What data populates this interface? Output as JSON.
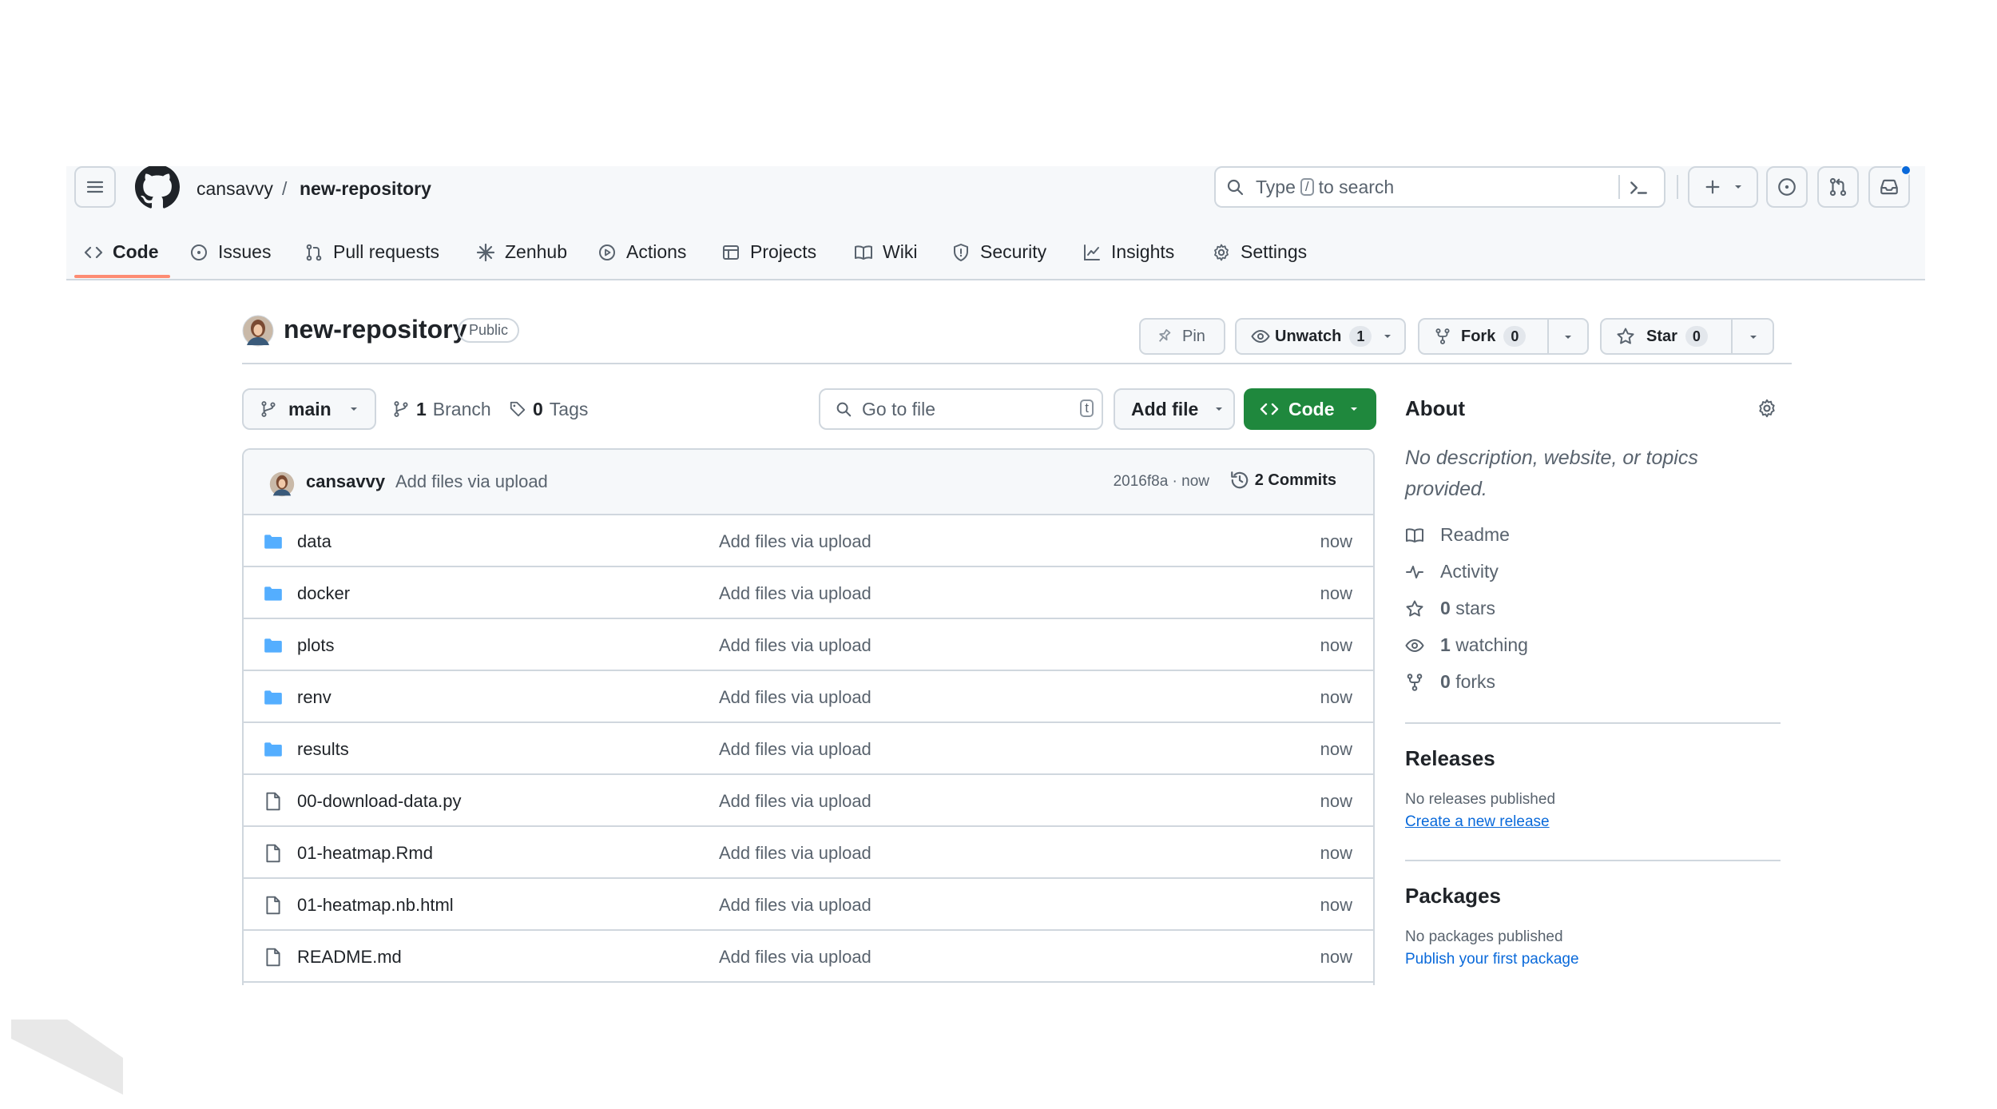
{
  "header": {
    "owner": "cansavvy",
    "separator": "/",
    "repo": "new-repository",
    "search_prefix": "Type",
    "search_key": "/",
    "search_suffix": "to search"
  },
  "tabs": [
    {
      "label": "Code",
      "selected": true
    },
    {
      "label": "Issues"
    },
    {
      "label": "Pull requests"
    },
    {
      "label": "Zenhub"
    },
    {
      "label": "Actions"
    },
    {
      "label": "Projects"
    },
    {
      "label": "Wiki"
    },
    {
      "label": "Security"
    },
    {
      "label": "Insights"
    },
    {
      "label": "Settings"
    }
  ],
  "repo_header": {
    "name": "new-repository",
    "visibility": "Public",
    "pin_label": "Pin",
    "unwatch_label": "Unwatch",
    "watch_count": "1",
    "fork_label": "Fork",
    "fork_count": "0",
    "star_label": "Star",
    "star_count": "0"
  },
  "toolbar": {
    "branch": "main",
    "branch_count": "1",
    "branch_word": "Branch",
    "tag_count": "0",
    "tag_word": "Tags",
    "goto_placeholder": "Go to file",
    "goto_key": "t",
    "add_file_label": "Add file",
    "code_label": "Code"
  },
  "commit": {
    "user": "cansavvy",
    "message": "Add files via upload",
    "sha_time": "2016f8a · now",
    "commits_label": "2 Commits"
  },
  "files": [
    {
      "name": "data",
      "type": "folder",
      "message": "Add files via upload",
      "date": "now"
    },
    {
      "name": "docker",
      "type": "folder",
      "message": "Add files via upload",
      "date": "now"
    },
    {
      "name": "plots",
      "type": "folder",
      "message": "Add files via upload",
      "date": "now"
    },
    {
      "name": "renv",
      "type": "folder",
      "message": "Add files via upload",
      "date": "now"
    },
    {
      "name": "results",
      "type": "folder",
      "message": "Add files via upload",
      "date": "now"
    },
    {
      "name": "00-download-data.py",
      "type": "file",
      "message": "Add files via upload",
      "date": "now"
    },
    {
      "name": "01-heatmap.Rmd",
      "type": "file",
      "message": "Add files via upload",
      "date": "now"
    },
    {
      "name": "01-heatmap.nb.html",
      "type": "file",
      "message": "Add files via upload",
      "date": "now"
    },
    {
      "name": "README.md",
      "type": "file",
      "message": "Add files via upload",
      "date": "now"
    }
  ],
  "about": {
    "title": "About",
    "description": "No description, website, or topics provided.",
    "readme": "Readme",
    "activity": "Activity",
    "stars_count": "0",
    "stars_word": "stars",
    "watching_count": "1",
    "watching_word": "watching",
    "forks_count": "0",
    "forks_word": "forks"
  },
  "releases": {
    "title": "Releases",
    "empty": "No releases published",
    "link": "Create a new release"
  },
  "packages": {
    "title": "Packages",
    "empty": "No packages published",
    "link": "Publish your first package"
  },
  "colors": {
    "accent_green": "#1f883d",
    "link_blue": "#0969da",
    "tab_underline": "#fd8c73",
    "folder_blue": "#54aeff"
  }
}
